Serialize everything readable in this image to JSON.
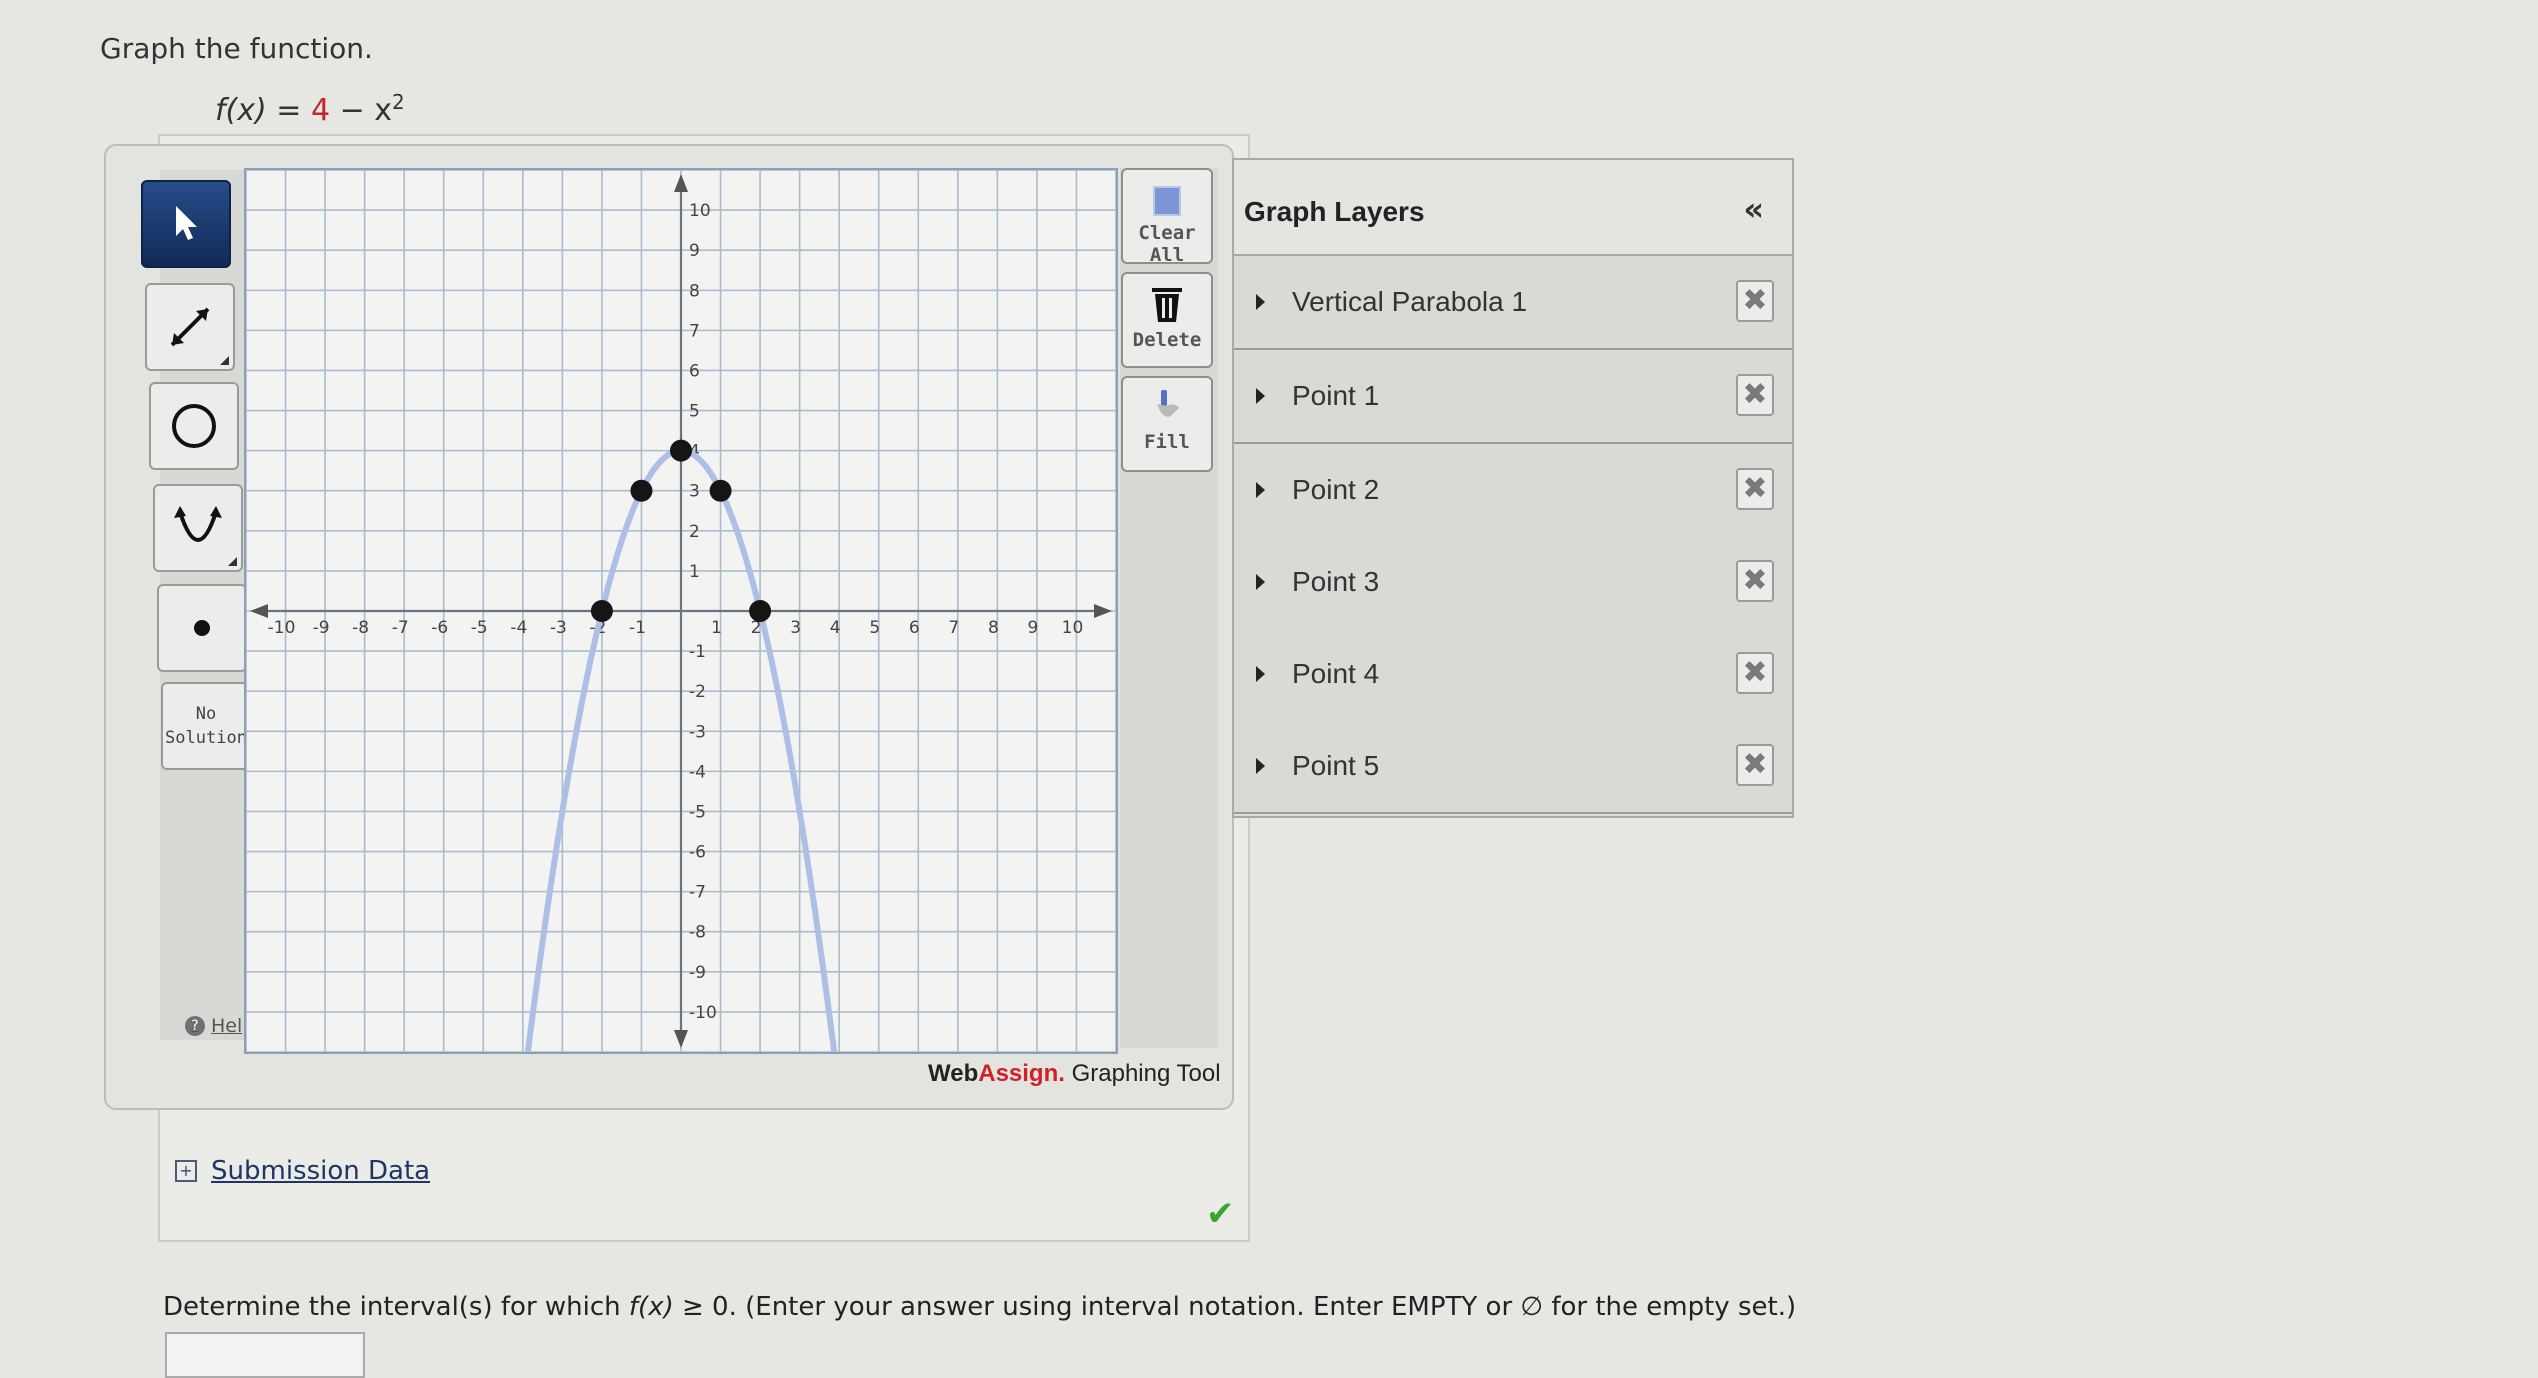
{
  "prompt": {
    "title": "Graph the function.",
    "formula_lhs": "f(x) =",
    "formula_const": "4",
    "formula_rest": "− x",
    "formula_exp": "2"
  },
  "toolbar_left": {
    "select_tool": "pointer-tool",
    "line_tool": "line-tool",
    "circle_tool": "circle-tool",
    "parabola_tool": "parabola-tool",
    "point_tool": "point-tool",
    "no_solution_line1": "No",
    "no_solution_line2": "Solution",
    "help_label": "Help"
  },
  "toolbar_right": {
    "clear_all_label": "Clear All",
    "delete_label": "Delete",
    "fill_label": "Fill"
  },
  "branding": {
    "web": "Web",
    "assign": "Assign.",
    "tool": " Graphing Tool"
  },
  "layers": {
    "title": "Graph Layers",
    "collapse_icon": "«",
    "items": [
      {
        "label": "Vertical Parabola 1"
      },
      {
        "label": "Point 1"
      },
      {
        "label": "Point 2"
      },
      {
        "label": "Point 3"
      },
      {
        "label": "Point 4"
      },
      {
        "label": "Point 5"
      }
    ],
    "remove_icon": "✖"
  },
  "submission": {
    "label": "Submission Data",
    "expand_icon": "+",
    "status_icon": "✔"
  },
  "question": {
    "text_before": "Determine the interval(s) for which ",
    "fx": "f(x)",
    "text_after": " ≥ 0. (Enter your answer using interval notation. Enter EMPTY or ∅ for the empty set.)",
    "answer_value": ""
  },
  "chart_data": {
    "type": "line",
    "title": "",
    "function": "f(x) = 4 - x^2",
    "xlim": [
      -11,
      11
    ],
    "ylim": [
      -11,
      11
    ],
    "x_ticks": [
      -10,
      -9,
      -8,
      -7,
      -6,
      -5,
      -4,
      -3,
      -2,
      -1,
      1,
      2,
      3,
      4,
      5,
      6,
      7,
      8,
      9,
      10
    ],
    "y_ticks": [
      -10,
      -9,
      -8,
      -7,
      -6,
      -5,
      -4,
      -3,
      -2,
      -1,
      1,
      2,
      3,
      4,
      5,
      6,
      7,
      8,
      9,
      10
    ],
    "grid": true,
    "series": [
      {
        "name": "Vertical Parabola 1",
        "kind": "curve",
        "a": -1,
        "h": 0,
        "k": 4,
        "color": "#aebfe6"
      }
    ],
    "points": [
      {
        "name": "Point 1",
        "x": 0,
        "y": 4
      },
      {
        "name": "Point 2",
        "x": -1,
        "y": 3
      },
      {
        "name": "Point 3",
        "x": 1,
        "y": 3
      },
      {
        "name": "Point 4",
        "x": -2,
        "y": 0
      },
      {
        "name": "Point 5",
        "x": 2,
        "y": 0
      }
    ]
  }
}
